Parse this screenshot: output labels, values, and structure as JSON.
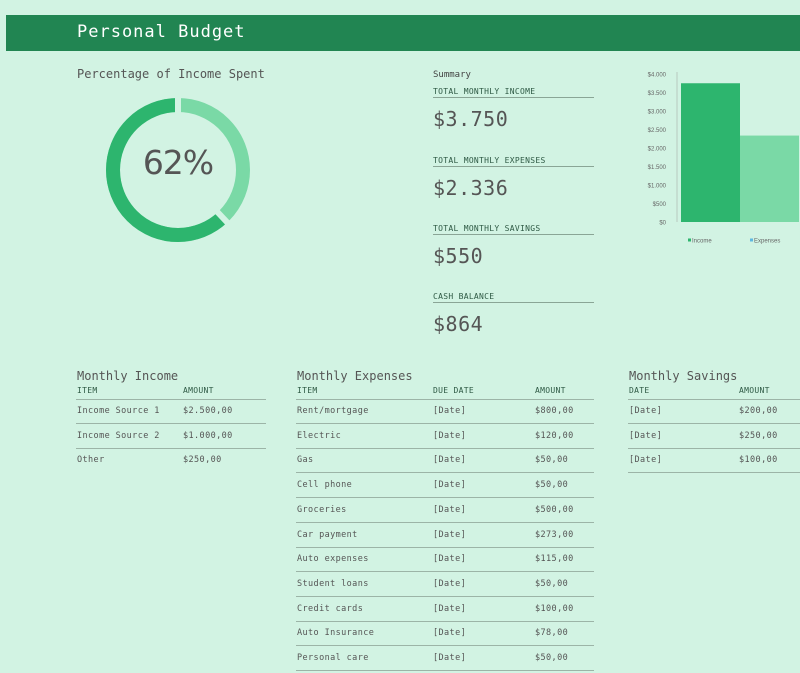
{
  "header": {
    "title": "Personal Budget"
  },
  "percentage": {
    "label": "Percentage of Income Spent",
    "value_text": "62%",
    "fraction": 0.62
  },
  "summary": {
    "heading": "Summary",
    "items": [
      {
        "label": "TOTAL MONTHLY INCOME",
        "value": "$3.750"
      },
      {
        "label": "TOTAL MONTHLY EXPENSES",
        "value": "$2.336"
      },
      {
        "label": "TOTAL MONTHLY SAVINGS",
        "value": "$550"
      },
      {
        "label": "CASH BALANCE",
        "value": "$864"
      }
    ]
  },
  "chart_data": {
    "type": "bar",
    "categories": [
      "Income",
      "Expenses"
    ],
    "values": [
      3750,
      2336
    ],
    "colors": [
      "#2db56e",
      "#7ad9a6"
    ],
    "y_ticks": [
      "$0",
      "$500",
      "$1.000",
      "$1.500",
      "$2.000",
      "$2.500",
      "$3.000",
      "$3.500",
      "$4.000"
    ],
    "ylim": [
      0,
      4000
    ],
    "legend": [
      "Income",
      "Expenses"
    ],
    "legend_position": "bottom"
  },
  "income": {
    "title": "Monthly Income",
    "headers": [
      "ITEM",
      "AMOUNT"
    ],
    "rows": [
      [
        "Income Source 1",
        "$2.500,00"
      ],
      [
        "Income Source 2",
        "$1.000,00"
      ],
      [
        "Other",
        "$250,00"
      ]
    ]
  },
  "expenses": {
    "title": "Monthly Expenses",
    "headers": [
      "ITEM",
      "DUE DATE",
      "AMOUNT"
    ],
    "rows": [
      [
        "Rent/mortgage",
        "[Date]",
        "$800,00"
      ],
      [
        "Electric",
        "[Date]",
        "$120,00"
      ],
      [
        "Gas",
        "[Date]",
        "$50,00"
      ],
      [
        "Cell phone",
        "[Date]",
        "$50,00"
      ],
      [
        "Groceries",
        "[Date]",
        "$500,00"
      ],
      [
        "Car payment",
        "[Date]",
        "$273,00"
      ],
      [
        "Auto expenses",
        "[Date]",
        "$115,00"
      ],
      [
        "Student loans",
        "[Date]",
        "$50,00"
      ],
      [
        "Credit cards",
        "[Date]",
        "$100,00"
      ],
      [
        "Auto Insurance",
        "[Date]",
        "$78,00"
      ],
      [
        "Personal care",
        "[Date]",
        "$50,00"
      ]
    ]
  },
  "savings": {
    "title": "Monthly Savings",
    "headers": [
      "DATE",
      "AMOUNT"
    ],
    "rows": [
      [
        "[Date]",
        "$200,00"
      ],
      [
        "[Date]",
        "$250,00"
      ],
      [
        "[Date]",
        "$100,00"
      ]
    ]
  }
}
